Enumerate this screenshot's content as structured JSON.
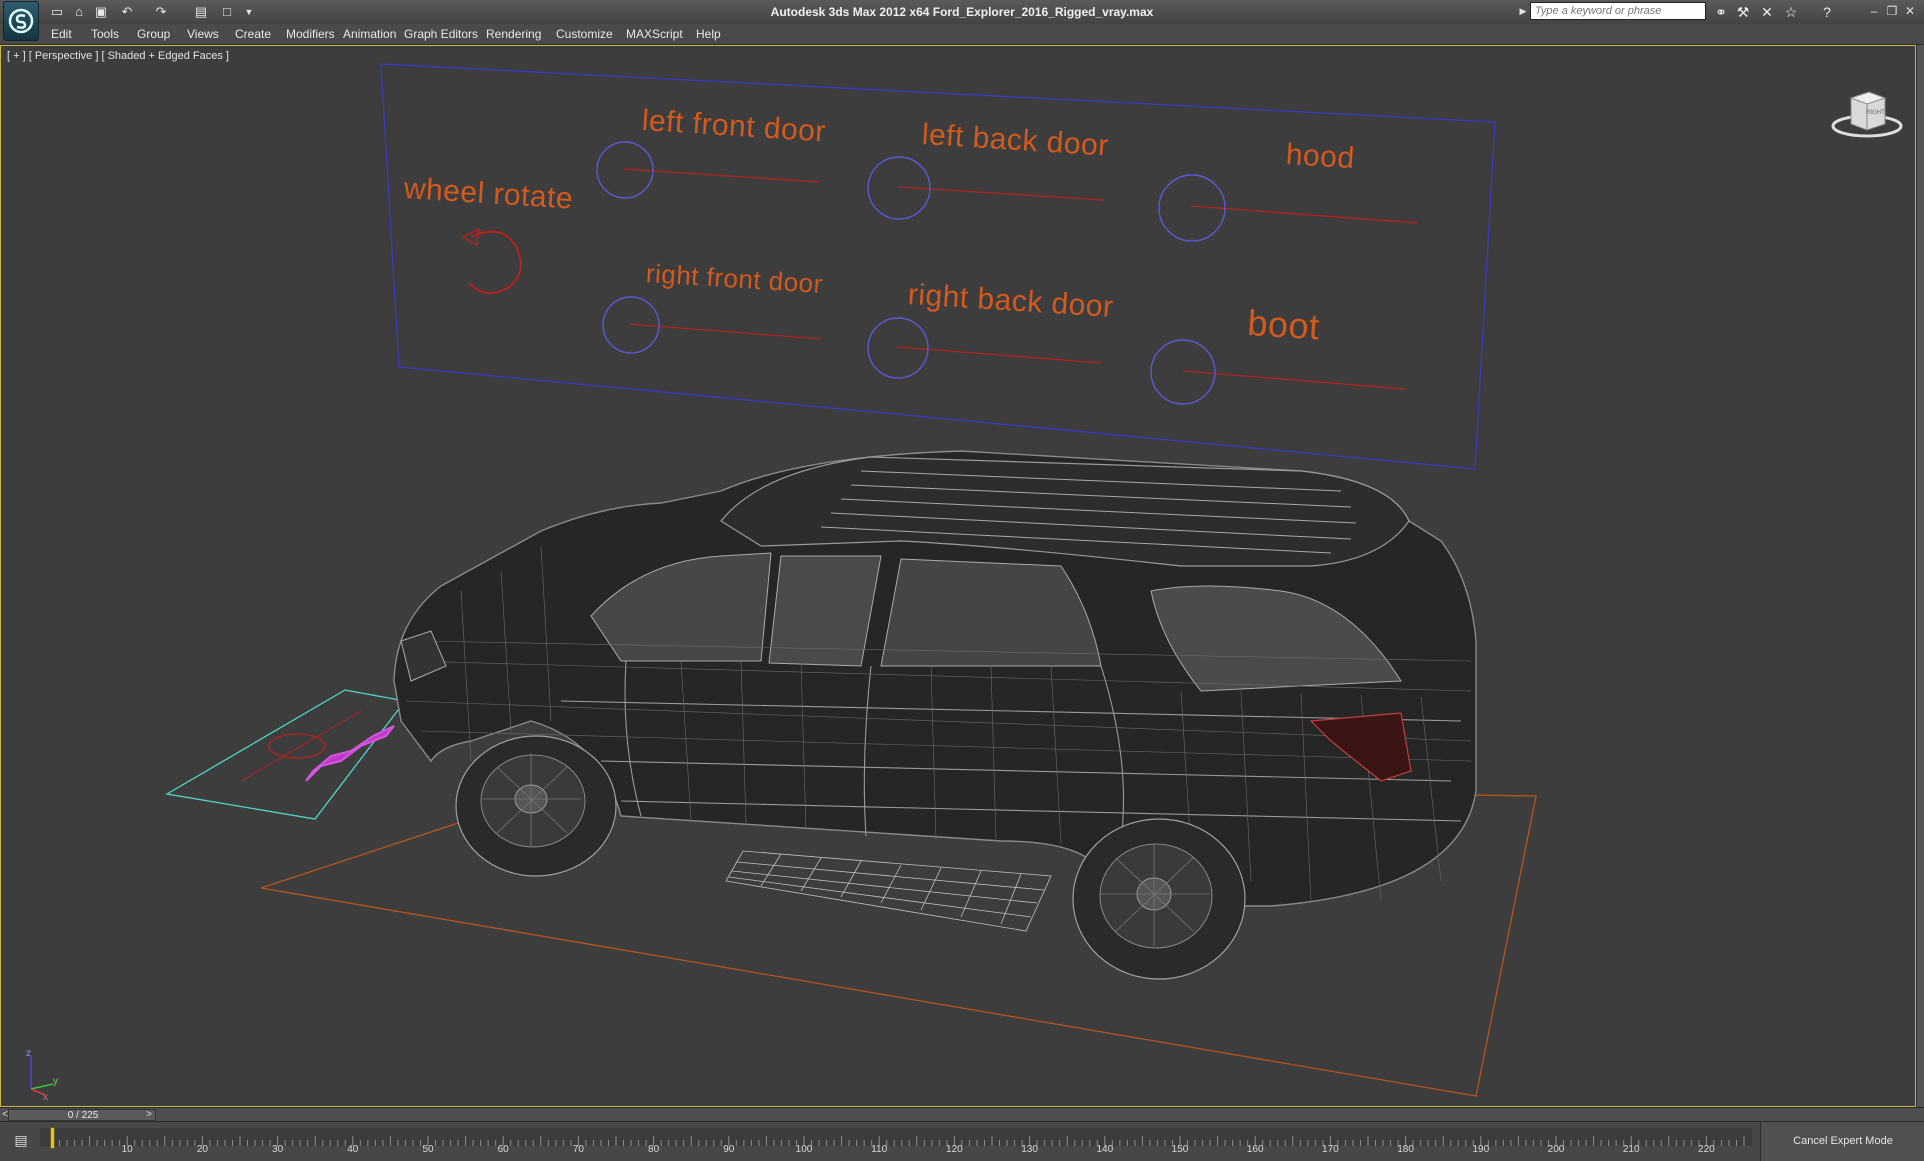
{
  "window": {
    "title": "Autodesk 3ds Max  2012 x64     Ford_Explorer_2016_Rigged_vray.max",
    "search_placeholder": "Type a keyword or phrase"
  },
  "menu": {
    "items": [
      "Edit",
      "Tools",
      "Group",
      "Views",
      "Create",
      "Modifiers",
      "Animation",
      "Graph Editors",
      "Rendering",
      "Customize",
      "MAXScript",
      "Help"
    ]
  },
  "viewport": {
    "label": "[ + ] [ Perspective ] [ Shaded + Edged Faces ]",
    "viewcube_label": "RIGHT"
  },
  "rig_controls": {
    "labels": {
      "wheel_rotate": "wheel rotate",
      "left_front_door": "left front door",
      "left_back_door": "left back door",
      "hood": "hood",
      "right_front_door": "right front door",
      "right_back_door": "right back door",
      "boot": "boot"
    }
  },
  "timeline": {
    "frame_counter": "0 / 225",
    "prev_arrow": "<",
    "next_arrow": ">",
    "ticks": [
      "10",
      "20",
      "30",
      "40",
      "50",
      "60",
      "70",
      "80",
      "90",
      "100",
      "110",
      "120",
      "130",
      "140",
      "150",
      "160",
      "170",
      "180",
      "190",
      "200",
      "210",
      "220"
    ]
  },
  "status": {
    "expert_mode_button": "Cancel Expert Mode"
  },
  "axis_tripod": {
    "x": "x",
    "y": "y",
    "z": "z"
  },
  "colors": {
    "label_orange": "#d25a1e",
    "slider_red": "#b0231f",
    "circle_blue": "#5a5ad0",
    "panel_blue": "#3a3ab8",
    "ground_orange": "#b6541e",
    "helper_cyan": "#4fd6c6",
    "helper_magenta": "#c03ac8",
    "viewport_active": "#c9b84a"
  }
}
